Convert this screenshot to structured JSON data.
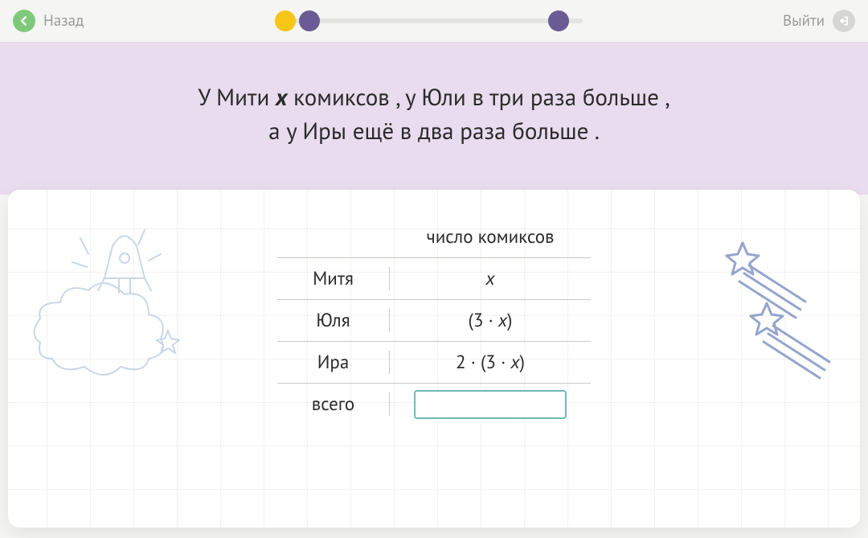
{
  "topbar": {
    "back_label": "Назад",
    "exit_label": "Выйти"
  },
  "progress": {
    "dots": [
      {
        "color": "yellow",
        "pos": 0
      },
      {
        "color": "purple",
        "pos": 8
      },
      {
        "color": "purple",
        "pos": 92
      }
    ]
  },
  "prompt": {
    "line1_a": "У Мити ",
    "line1_var": "х",
    "line1_b": " комиксов ,  у Юли в три раза больше ,",
    "line2": "а у Иры ещё в два раза больше ."
  },
  "table": {
    "header_value": "число комиксов",
    "rows": [
      {
        "name": "Митя",
        "value_html": "<span class='it'>x</span>"
      },
      {
        "name": "Юля",
        "value_html": "(3 · <span class='it'>x</span>)"
      },
      {
        "name": "Ира",
        "value_html": "2 · (3 · <span class='it'>x</span>)"
      }
    ],
    "total_label": "всего",
    "answer_value": ""
  }
}
